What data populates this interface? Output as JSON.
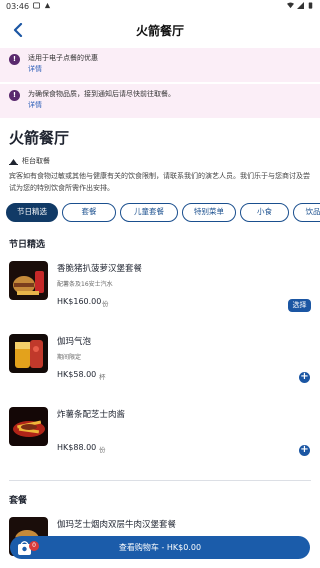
{
  "status_bar": {
    "time": "03:46"
  },
  "header": {
    "title": "火箭餐厅"
  },
  "notices": [
    {
      "text": "适用于电子点餐的优惠",
      "link": "详情"
    },
    {
      "text": "为确保食物品质，接到通知后请尽快前往取餐。",
      "link": "详情"
    }
  ],
  "restaurant": {
    "name": "火箭餐厅",
    "pickup_label": "柜台取餐",
    "description": "宾客如有食物过敏或其他与健康有关的饮食限制，请联系我们的演艺人员。我们乐于与您商讨及尝试为您的特别饮食所需作出安排。"
  },
  "tabs": [
    "节日精选",
    "套餐",
    "儿童套餐",
    "特别菜单",
    "小食",
    "饮品"
  ],
  "sections": [
    {
      "title": "节日精选",
      "items": [
        {
          "name": "香脆猪扒菠萝汉堡套餐",
          "sub": "配薯条及16安士汽水",
          "price": "HK$160.00",
          "unit": "份",
          "action": "选择"
        },
        {
          "name": "伽玛气泡",
          "sub": "期间限定",
          "price": "HK$58.00",
          "unit": "杯",
          "action": "+"
        },
        {
          "name": "炸薯条配芝士肉酱",
          "sub": "",
          "price": "HK$88.00",
          "unit": "份",
          "action": "+"
        }
      ]
    },
    {
      "title": "套餐",
      "items": [
        {
          "name": "伽玛芝士烟肉双层牛肉汉堡套餐"
        }
      ]
    }
  ],
  "cart": {
    "label": "查看购物车 - HK$0.00",
    "count": "0"
  },
  "colors": {
    "primary": "#1b5caa",
    "notice_bg": "#fbeef7",
    "tab_active": "#113a66",
    "badge": "#d93a3a"
  }
}
